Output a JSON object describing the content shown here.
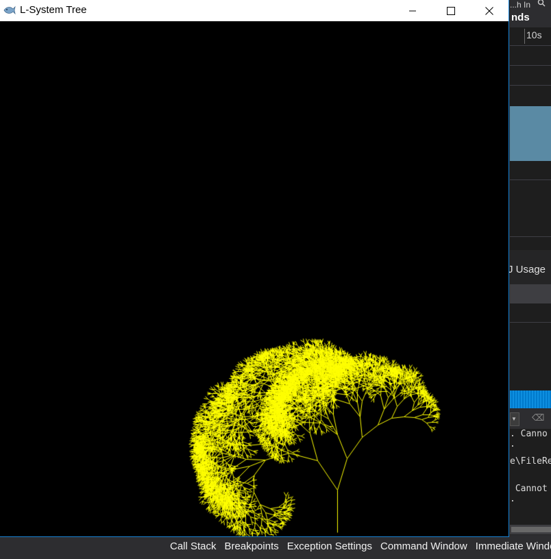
{
  "window": {
    "title": "L-System Tree",
    "app_icon": "fish-icon",
    "minimize_icon": "minimize-icon",
    "maximize_icon": "maximize-icon",
    "close_icon": "close-icon"
  },
  "canvas": {
    "background_color": "#000000",
    "stroke_color": "#ffff00"
  },
  "ide_background": {
    "top_cut_text": "...h In",
    "top_heading": "nds",
    "ruler_label": "10s",
    "usage_label": "J Usage",
    "output_lines": [
      ". Canno",
      ".",
      "e\\FileRep",
      "",
      " Cannot",
      "."
    ]
  },
  "bottom_tabs": [
    "Call Stack",
    "Breakpoints",
    "Exception Settings",
    "Command Window",
    "Immediate Window"
  ],
  "colors": {
    "accent_blue": "#007acc",
    "window_border": "#1883d7",
    "ide_dark": "#1e1e1e",
    "ide_panel": "#2d2d30"
  }
}
